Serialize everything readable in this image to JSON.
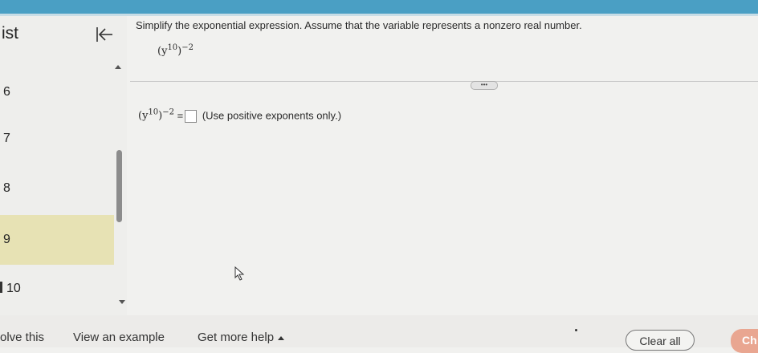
{
  "sidebar": {
    "title": "ist",
    "items": [
      {
        "label": "6"
      },
      {
        "label": "7"
      },
      {
        "label": "8"
      },
      {
        "label": "9"
      },
      {
        "label": "10"
      }
    ]
  },
  "question": {
    "instruction": "Simplify the exponential expression. Assume that the variable represents a nonzero real number.",
    "expr_base": "y",
    "expr_inner_exp": "10",
    "expr_outer_exp": "−2",
    "more_label": "•••",
    "answer_equals": "=",
    "answer_hint": "(Use positive exponents only.)"
  },
  "footer": {
    "solve_label": "olve this",
    "example_label": "View an example",
    "help_label": "Get more help",
    "clear_label": "Clear all",
    "check_label": "Ch"
  },
  "colors": {
    "topbar": "#4a9fc4",
    "active_item": "#e7e2b4",
    "check_button": "#e9a691"
  }
}
